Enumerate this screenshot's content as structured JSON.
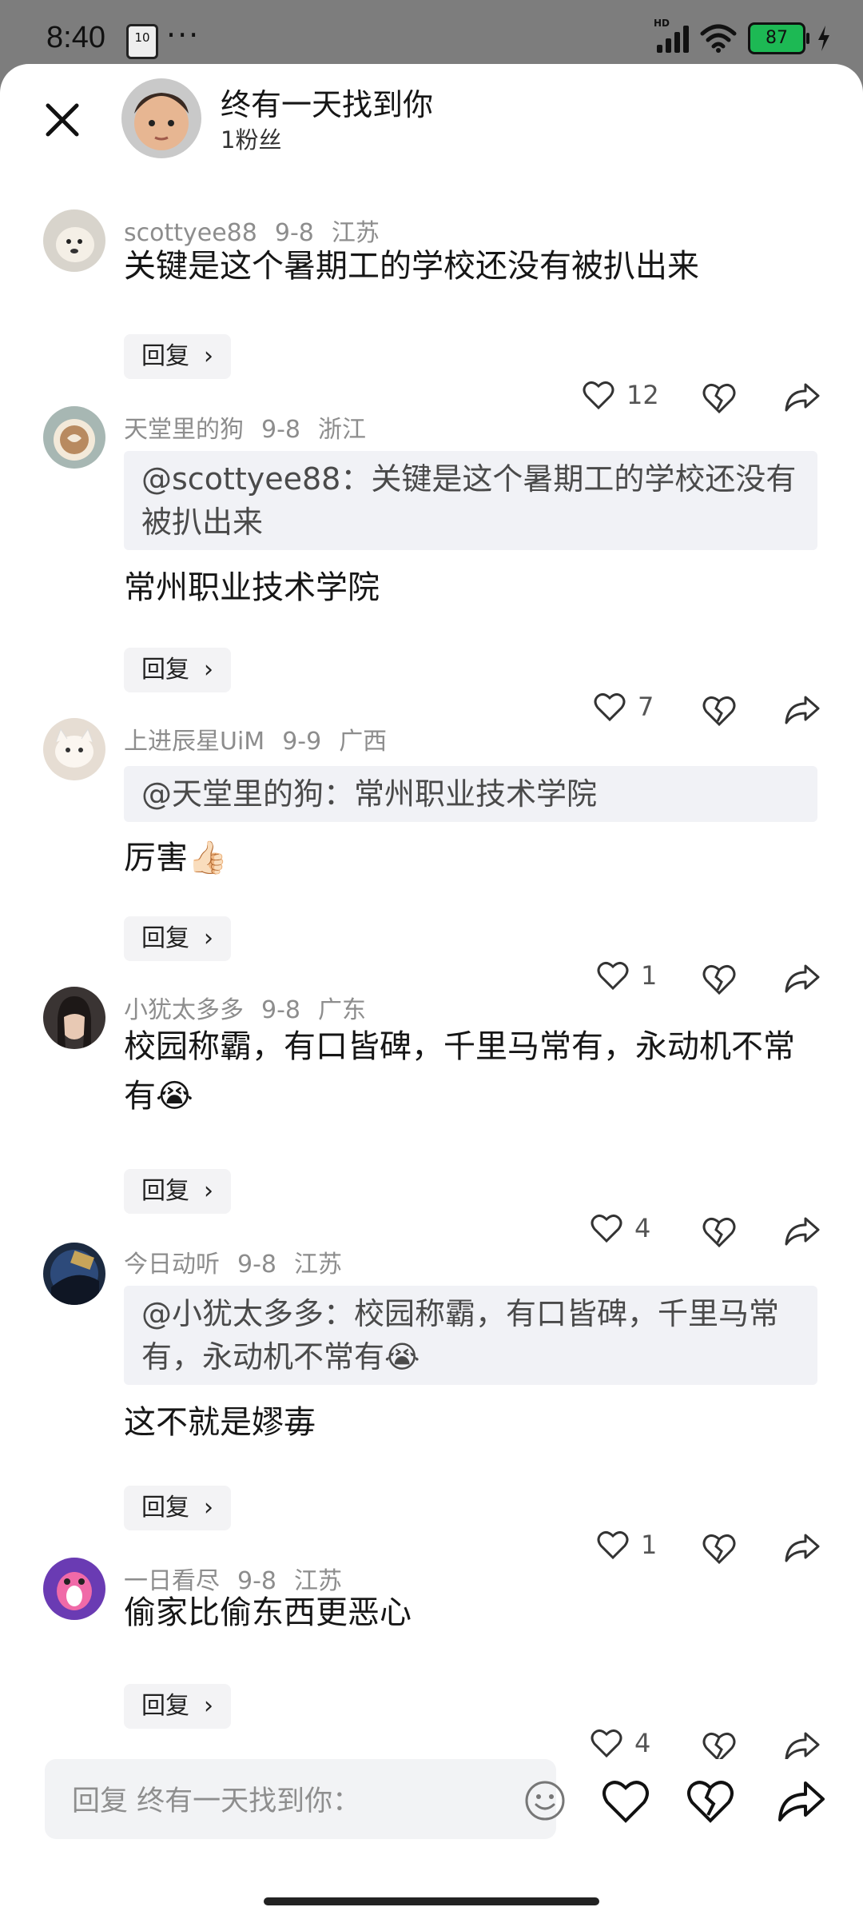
{
  "status": {
    "time": "8:40",
    "note_badge": "10",
    "dots": "···",
    "network": "HD",
    "battery": "87"
  },
  "header": {
    "title": "终有一天找到你",
    "subtitle": "1粉丝"
  },
  "comments": [
    {
      "user": "scottyee88",
      "date": "9-8",
      "location": "江苏",
      "quote": "",
      "text": "关键是这个暑期工的学校还没有被扒出来",
      "reply_label": "回复",
      "likes": "12"
    },
    {
      "user": "天堂里的狗",
      "date": "9-8",
      "location": "浙江",
      "quote": "@scottyee88：关键是这个暑期工的学校还没有被扒出来",
      "text": "常州职业技术学院",
      "reply_label": "回复",
      "likes": "7"
    },
    {
      "user": "上进辰星UiM",
      "date": "9-9",
      "location": "广西",
      "quote": "@天堂里的狗：常州职业技术学院",
      "text": "厉害👍🏻",
      "reply_label": "回复",
      "likes": "1"
    },
    {
      "user": "小犹太多多",
      "date": "9-8",
      "location": "广东",
      "quote": "",
      "text": "校园称霸，有口皆碑，千里马常有，永动机不常有😭",
      "reply_label": "回复",
      "likes": "4"
    },
    {
      "user": "今日动听",
      "date": "9-8",
      "location": "江苏",
      "quote": "@小犹太多多：校园称霸，有口皆碑，千里马常有，永动机不常有😭",
      "text": "这不就是嫪毐",
      "reply_label": "回复",
      "likes": "1"
    },
    {
      "user": "一日看尽",
      "date": "9-8",
      "location": "江苏",
      "quote": "",
      "text": "偷家比偷东西更恶心",
      "reply_label": "回复",
      "likes": "4"
    }
  ],
  "input": {
    "placeholder": "回复 终有一天找到你："
  },
  "icons": {
    "like": "heart-outline-icon",
    "dislike": "broken-heart-icon",
    "share": "share-arrow-icon",
    "close": "close-icon",
    "emoji": "smiley-icon"
  }
}
